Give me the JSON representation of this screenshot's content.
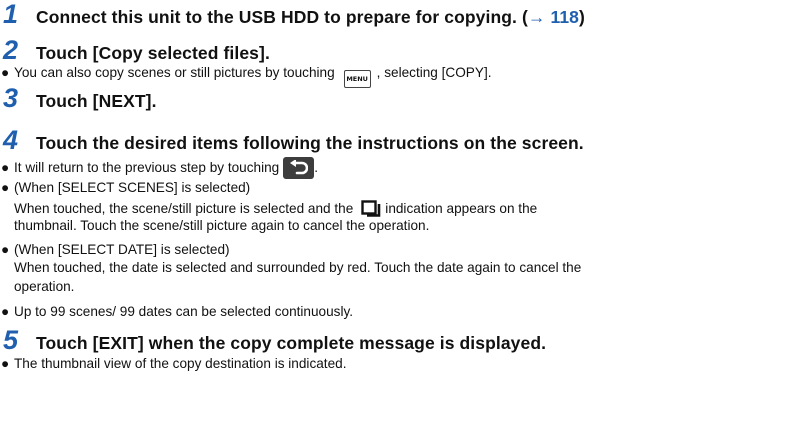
{
  "steps": [
    {
      "num": "1",
      "text": "Connect this unit to the USB HDD to prepare for copying. (",
      "xref": "→ 118",
      "after": ")"
    },
    {
      "num": "2",
      "text": "Touch [Copy selected files]."
    },
    {
      "num": "3",
      "text": "Touch [NEXT]."
    },
    {
      "num": "4",
      "text": "Touch the desired items following the instructions on the screen."
    },
    {
      "num": "5",
      "text": "Touch [EXIT] when the copy complete message is displayed."
    }
  ],
  "bullet_marker": "●",
  "step2_bullet": {
    "before": "You can also copy scenes or still pictures by touching",
    "key": "MENU",
    "after": ", selecting [COPY]."
  },
  "step4_bullets": {
    "b1": {
      "before": "It will return to the previous step by touching",
      "after": "."
    },
    "b2": {
      "line1": "(When [SELECT SCENES] is selected)",
      "line2_before": "When touched, the scene/still picture is selected and the",
      "line2_after": "indication appears on the",
      "line3": "thumbnail. Touch the scene/still picture again to cancel the operation."
    },
    "b3": {
      "line1": "(When [SELECT DATE] is selected)",
      "line2": "When touched, the date is selected and surrounded by red. Touch the date again to cancel the",
      "line3": "operation."
    },
    "b4": "Up to 99 scenes/ 99 dates can be selected continuously."
  },
  "step5_bullet": "The thumbnail view of the copy destination is indicated.",
  "colors": {
    "step_number": "#1f5fae",
    "xref": "#1f5fae",
    "back_button": "#3d3d3d"
  },
  "icons": {
    "menu_key": "menu-key-icon",
    "back": "back-arrow-icon",
    "selection": "selection-mark-icon"
  }
}
